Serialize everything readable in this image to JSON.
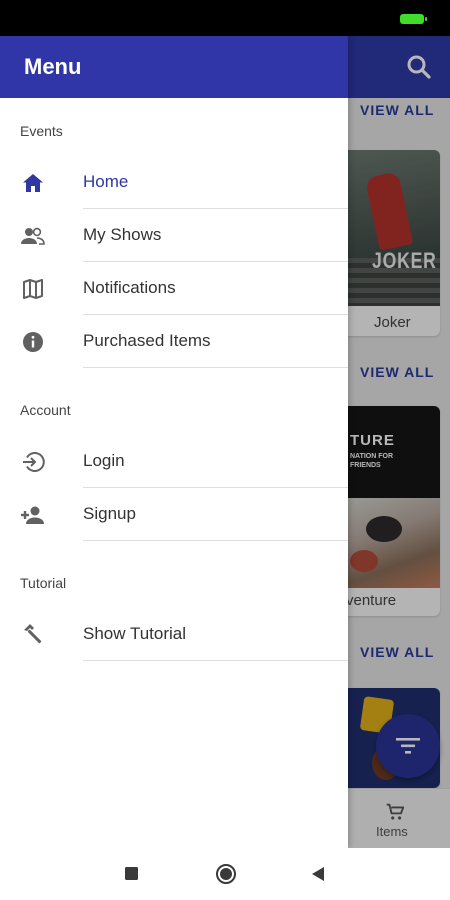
{
  "background": {
    "view_all_label": "VIEW ALL",
    "cards": [
      {
        "title": "Joker",
        "poster_text": "JOKER"
      },
      {
        "title": "venture",
        "poster_text": "TURE",
        "poster_subtext": "NATION FOR FRIENDS"
      },
      {
        "title": ""
      }
    ],
    "tabbar": {
      "items_label": "Items"
    }
  },
  "drawer": {
    "title": "Menu",
    "sections": [
      {
        "label": "Events",
        "items": [
          {
            "label": "Home",
            "icon": "home-icon",
            "active": true
          },
          {
            "label": "My Shows",
            "icon": "people-icon"
          },
          {
            "label": "Notifications",
            "icon": "map-icon"
          },
          {
            "label": "Purchased Items",
            "icon": "info-icon"
          }
        ]
      },
      {
        "label": "Account",
        "items": [
          {
            "label": "Login",
            "icon": "login-icon"
          },
          {
            "label": "Signup",
            "icon": "person-add-icon"
          }
        ]
      },
      {
        "label": "Tutorial",
        "items": [
          {
            "label": "Show Tutorial",
            "icon": "hammer-icon"
          }
        ]
      }
    ]
  },
  "colors": {
    "primary": "#3036a7",
    "active_text": "#2f37a3",
    "fab": "#2a3497"
  }
}
